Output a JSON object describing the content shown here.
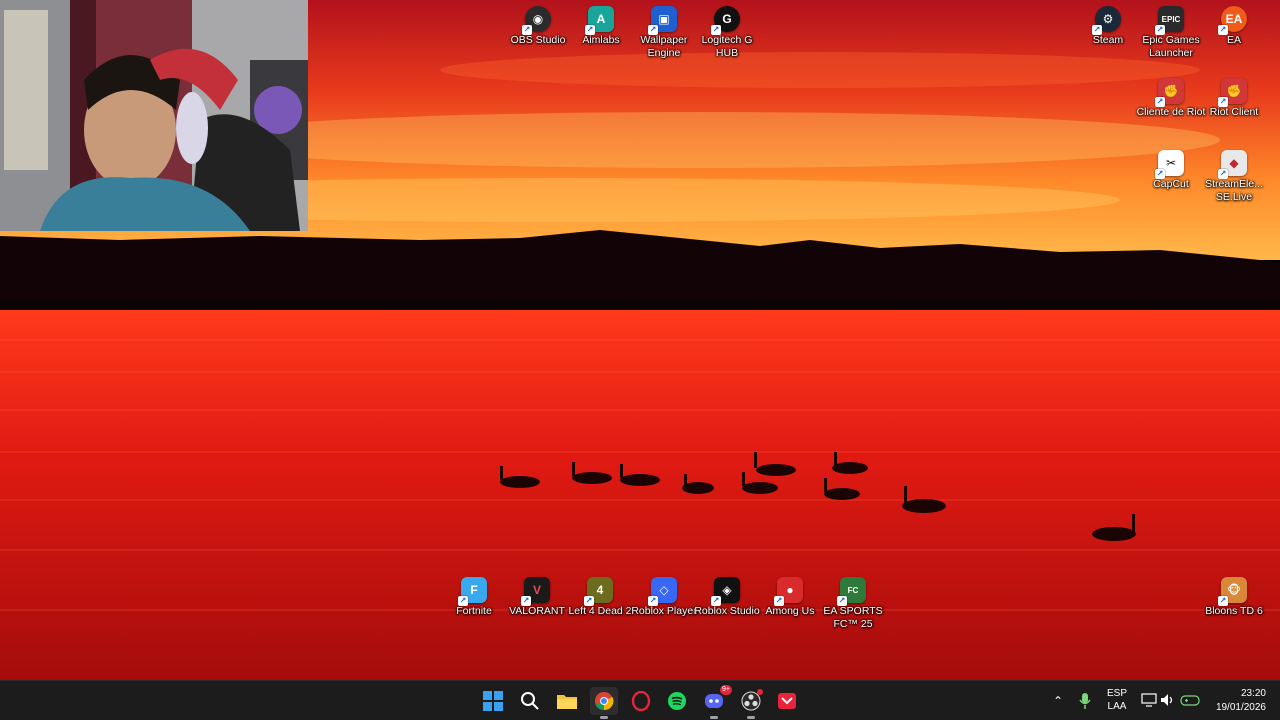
{
  "desktop": {
    "top_icons": [
      {
        "label": "OBS Studio",
        "icon": "obs-icon",
        "color": "#2b2b2b"
      },
      {
        "label": "Aimlabs",
        "icon": "aimlabs-icon",
        "color": "#1aa59a"
      },
      {
        "label": "Wallpaper Engine",
        "icon": "wallpaper-engine-icon",
        "color": "#1f5fd0"
      },
      {
        "label": "Logitech G HUB",
        "icon": "logitech-ghub-icon",
        "color": "#111111"
      }
    ],
    "right_icons": [
      {
        "label": "Steam",
        "icon": "steam-icon",
        "color": "#1b2838"
      },
      {
        "label": "Epic Games Launcher",
        "icon": "epic-games-icon",
        "color": "#2a2a2a"
      },
      {
        "label": "EA",
        "icon": "ea-icon",
        "color": "#f25a1a"
      },
      {
        "label": "Cliente de Riot",
        "icon": "riot-client-icon",
        "color": "#d13639"
      },
      {
        "label": "Riot Client",
        "icon": "riot-client-icon",
        "color": "#d13639"
      },
      {
        "label": "CapCut",
        "icon": "capcut-icon",
        "color": "#ffffff"
      },
      {
        "label": "StreamEle... SE.Live",
        "icon": "streamelements-icon",
        "color": "#e8e8e8"
      }
    ],
    "bottom_icons": [
      {
        "label": "Fortnite",
        "icon": "fortnite-icon",
        "color": "#3aa8ec"
      },
      {
        "label": "VALORANT",
        "icon": "valorant-icon",
        "color": "#1a1a1a"
      },
      {
        "label": "Left 4 Dead 2",
        "icon": "left4dead2-icon",
        "color": "#6d6b1e"
      },
      {
        "label": "Roblox Player",
        "icon": "roblox-player-icon",
        "color": "#3866f5"
      },
      {
        "label": "Roblox Studio",
        "icon": "roblox-studio-icon",
        "color": "#111111"
      },
      {
        "label": "Among Us",
        "icon": "among-us-icon",
        "color": "#d92b2b"
      },
      {
        "label": "EA SPORTS FC™ 25",
        "icon": "ea-sports-fc-icon",
        "color": "#2d7a3a"
      },
      {
        "label": "Bloons TD 6",
        "icon": "bloons-td6-icon",
        "color": "#d9883a"
      }
    ]
  },
  "taskbar": {
    "apps": [
      {
        "name": "start-button",
        "icon": "windows-icon"
      },
      {
        "name": "search-button",
        "icon": "search-icon"
      },
      {
        "name": "file-explorer",
        "icon": "folder-icon"
      },
      {
        "name": "chrome",
        "icon": "chrome-icon"
      },
      {
        "name": "opera-gx",
        "icon": "opera-icon"
      },
      {
        "name": "spotify",
        "icon": "spotify-icon"
      },
      {
        "name": "discord",
        "icon": "discord-icon",
        "badge": "9+"
      },
      {
        "name": "obs",
        "icon": "obs-icon"
      },
      {
        "name": "app-red",
        "icon": "app-icon"
      }
    ],
    "tray": {
      "lang_top": "ESP",
      "lang_bottom": "LAA",
      "time": "23:20",
      "date": "19/01/2026"
    }
  },
  "colors": {
    "taskbar_bg": "#1c1c1c",
    "sky_top": "#c8101a",
    "sky_glow": "#ffb23a",
    "water": "#d31414"
  }
}
